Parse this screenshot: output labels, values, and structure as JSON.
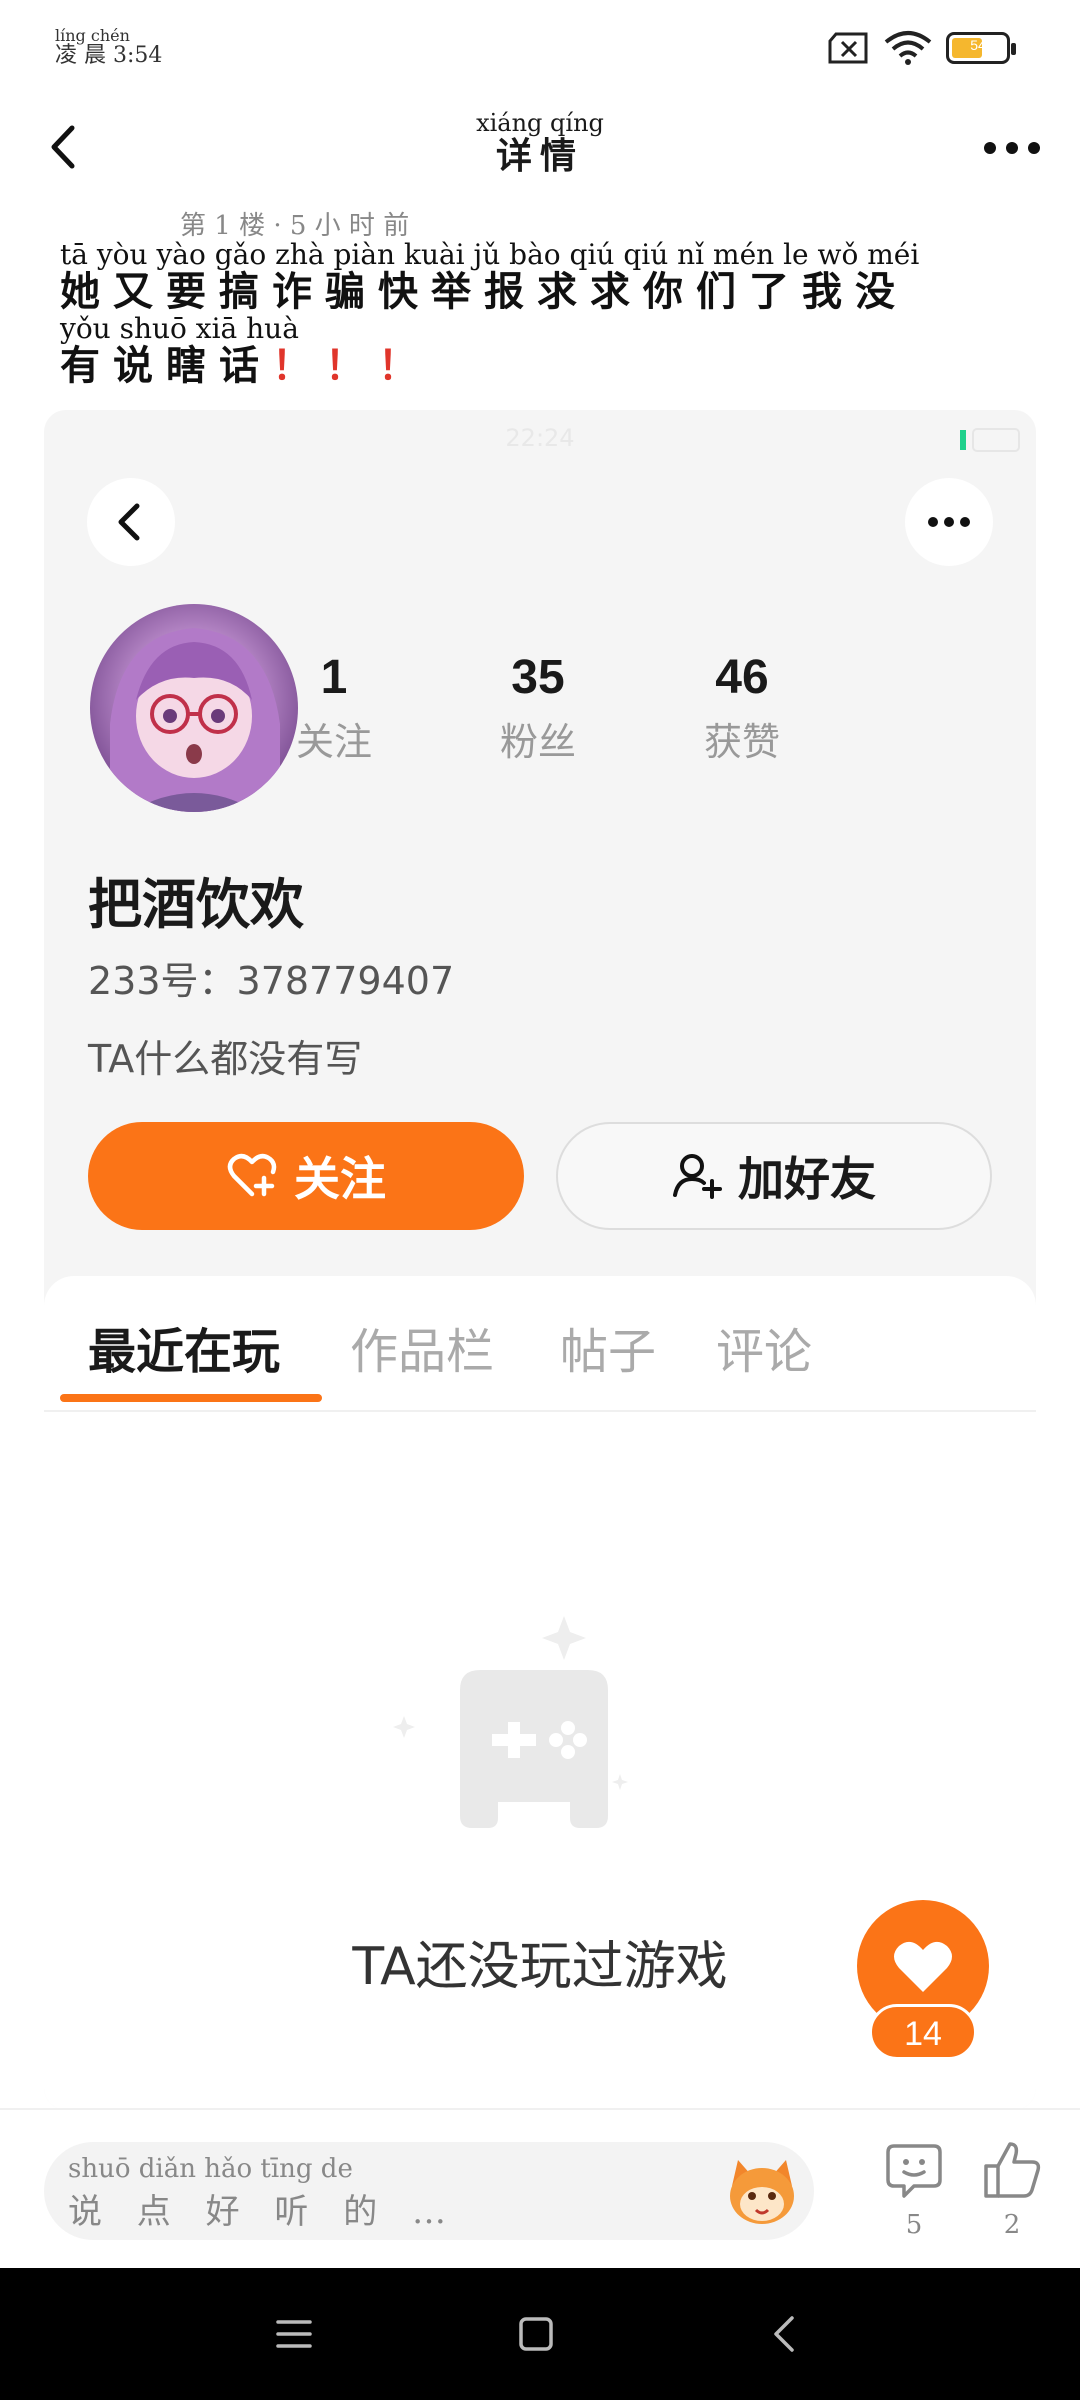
{
  "status_bar": {
    "time_pinyin": "líng chén",
    "time_hanzi": "凌 晨 3:54",
    "battery_label": "54"
  },
  "header": {
    "title_pinyin": "xiáng qíng",
    "title_hanzi": "详情"
  },
  "post": {
    "floor_info": "第 1 楼 · 5 小 时 前",
    "line1_pinyin": "tā yòu yào gǎo zhà piàn kuài jǔ bào qiú qiú nǐ mén le wǒ méi",
    "line1_hanzi": "她又要搞诈骗快举报求求你们了我没",
    "line2_pinyin": "yǒu shuō xiā huà",
    "line2_hanzi": "有说瞎话",
    "line2_exclaim": "！！！"
  },
  "embedded_profile": {
    "status_time": "22:24",
    "stats": [
      {
        "value": "1",
        "label": "关注"
      },
      {
        "value": "35",
        "label": "粉丝"
      },
      {
        "value": "46",
        "label": "获赞"
      }
    ],
    "username": "把酒饮欢",
    "uid_line": "233号：378779407",
    "bio": "TA什么都没有写",
    "follow_label": "关注",
    "add_friend_label": "加好友",
    "tabs": [
      "最近在玩",
      "作品栏",
      "帖子",
      "评论"
    ],
    "empty_text": "TA还没玩过游戏"
  },
  "floating_like": {
    "count": "14"
  },
  "bottom_bar": {
    "input_pinyin": "shuō diǎn hǎo tīng de",
    "input_hanzi": "说 点 好 听 的 …",
    "comment_count": "5",
    "like_count": "2"
  },
  "colors": {
    "accent": "#fb7417",
    "exclaim": "#e0352b",
    "card_bg": "#f5f5f5"
  },
  "icons": [
    "back-icon",
    "more-icon",
    "wifi-icon",
    "battery-icon",
    "sim-off-icon",
    "heart-plus-icon",
    "add-user-icon",
    "gamepad-icon",
    "heart-icon",
    "comment-icon",
    "thumbs-up-icon",
    "menu-icon",
    "home-square-icon",
    "nav-back-icon"
  ]
}
